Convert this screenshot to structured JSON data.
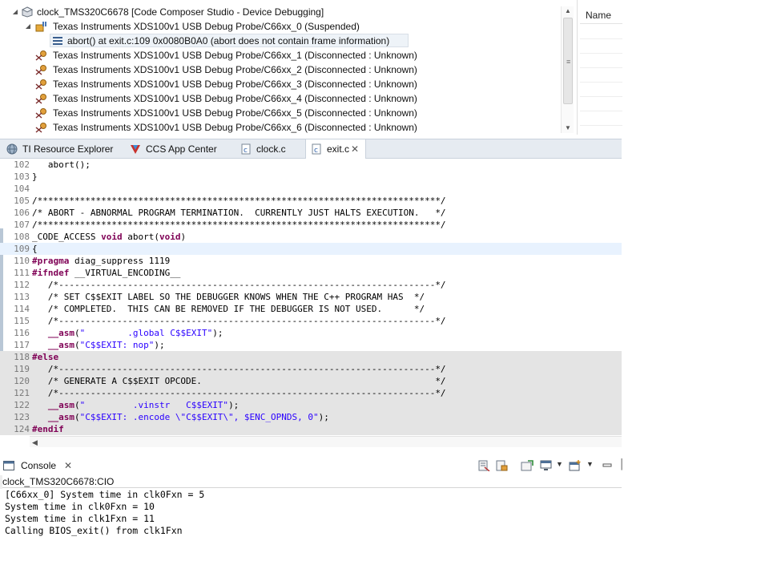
{
  "debug": {
    "root_label": "clock_TMS320C6678 [Code Composer Studio - Device Debugging]",
    "probe_suspended": "Texas Instruments XDS100v1 USB Debug Probe/C66xx_0 (Suspended)",
    "frame": "abort() at exit.c:109 0x0080B0A0  (abort does not contain frame information)",
    "disconnected": [
      "Texas Instruments XDS100v1 USB Debug Probe/C66xx_1 (Disconnected : Unknown)",
      "Texas Instruments XDS100v1 USB Debug Probe/C66xx_2 (Disconnected : Unknown)",
      "Texas Instruments XDS100v1 USB Debug Probe/C66xx_3 (Disconnected : Unknown)",
      "Texas Instruments XDS100v1 USB Debug Probe/C66xx_4 (Disconnected : Unknown)",
      "Texas Instruments XDS100v1 USB Debug Probe/C66xx_5 (Disconnected : Unknown)",
      "Texas Instruments XDS100v1 USB Debug Probe/C66xx_6 (Disconnected : Unknown)"
    ]
  },
  "variables": {
    "name_header": "Name"
  },
  "editor_tabs": {
    "resource_explorer": "TI Resource Explorer",
    "app_center": "CCS App Center",
    "clock_c": "clock.c",
    "exit_c": "exit.c"
  },
  "code": {
    "line_numbers": [
      "102",
      "103",
      "104",
      "105",
      "106",
      "107",
      "108",
      "109",
      "110",
      "111",
      "112",
      "113",
      "114",
      "115",
      "116",
      "117",
      "118",
      "119",
      "120",
      "121",
      "122",
      "123",
      "124"
    ]
  },
  "console": {
    "tab_label": "Console",
    "title": "clock_TMS320C6678:CIO",
    "lines": [
      "[C66xx_0] System time in clk0Fxn = 5",
      "System time in clk0Fxn = 10",
      "System time in clk1Fxn = 11",
      "Calling BIOS_exit() from clk1Fxn"
    ]
  },
  "colors": {
    "accent": "#3a6ea5",
    "comment": "#3f7f5f",
    "keyword": "#7f0055",
    "string": "#2a00ff"
  }
}
